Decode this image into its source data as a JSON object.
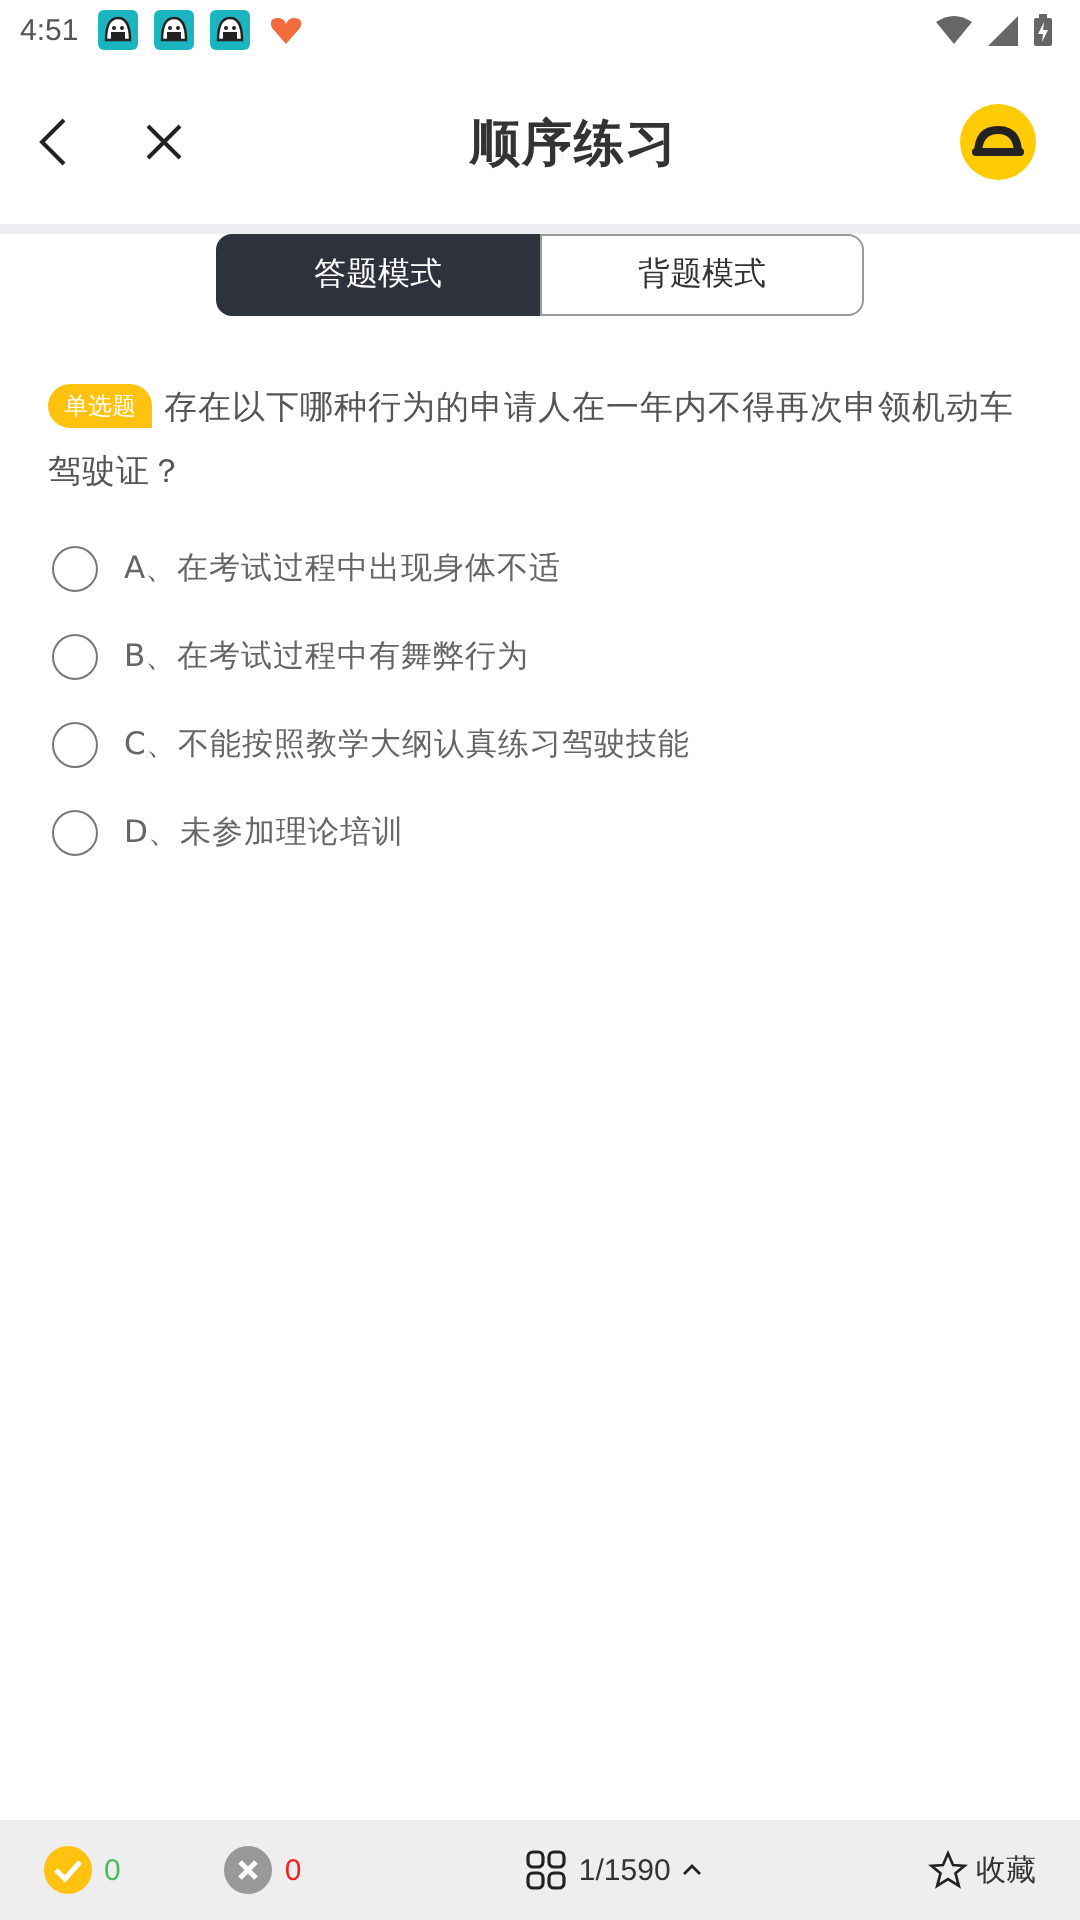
{
  "status_bar": {
    "time": "4:51"
  },
  "header": {
    "title": "顺序练习"
  },
  "tabs": [
    {
      "label": "答题模式",
      "selected": true
    },
    {
      "label": "背题模式",
      "selected": false
    }
  ],
  "question": {
    "type_badge": "单选题",
    "text": "存在以下哪种行为的申请人在一年内不得再次申领机动车驾驶证？"
  },
  "options": [
    {
      "text": "A、在考试过程中出现身体不适",
      "selected": false
    },
    {
      "text": "B、在考试过程中有舞弊行为",
      "selected": false
    },
    {
      "text": "C、不能按照教学大纲认真练习驾驶技能",
      "selected": false
    },
    {
      "text": "D、未参加理论培训",
      "selected": false
    }
  ],
  "bottom_bar": {
    "correct_count": "0",
    "wrong_count": "0",
    "progress": "1/1590",
    "favorite_label": "收藏"
  }
}
